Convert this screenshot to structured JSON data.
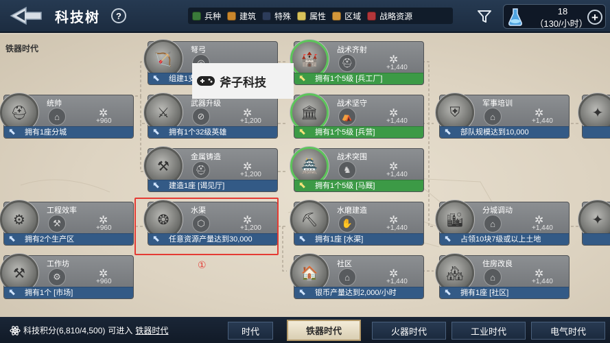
{
  "header": {
    "title": "科技树",
    "help_symbol": "?",
    "legend": [
      {
        "label": "兵种",
        "color": "#3a7a3a"
      },
      {
        "label": "建筑",
        "color": "#c9862c"
      },
      {
        "label": "特殊",
        "color": "#2c3c5a"
      },
      {
        "label": "属性",
        "color": "#d8c25a"
      },
      {
        "label": "区域",
        "color": "#d2963a"
      },
      {
        "label": "战略资源",
        "color": "#b2363a"
      }
    ],
    "resource": {
      "value": "18",
      "rate": "（130/小时）",
      "plus_symbol": "+"
    }
  },
  "tree": {
    "era_label": "铁器时代",
    "cards": [
      {
        "name": "弩弓",
        "points": "",
        "req": "组建1支",
        "req_style": "blue",
        "progress": false
      },
      {
        "name": "战术齐射",
        "points": "+1,440",
        "req": "拥有1个5级 [兵工厂]",
        "req_style": "green",
        "progress": true
      },
      {
        "name": "统帅",
        "points": "+960",
        "req": "拥有1座分城",
        "req_style": "blue",
        "progress": false
      },
      {
        "name": "武器升级",
        "points": "+1,200",
        "req": "拥有1个32级英雄",
        "req_style": "blue",
        "progress": false
      },
      {
        "name": "战术坚守",
        "points": "+1,440",
        "req": "拥有1个5级 [兵营]",
        "req_style": "green",
        "progress": true
      },
      {
        "name": "军事培训",
        "points": "+1,440",
        "req": "部队规模达到10,000",
        "req_style": "blue",
        "progress": false
      },
      {
        "name": "金属铸造",
        "points": "+1,200",
        "req": "建造1座 [谒见厅]",
        "req_style": "blue",
        "progress": false
      },
      {
        "name": "战术突围",
        "points": "+1,440",
        "req": "拥有1个5级 [马厩]",
        "req_style": "green",
        "progress": true
      },
      {
        "name": "工程效率",
        "points": "+960",
        "req": "拥有2个生产区",
        "req_style": "blue",
        "progress": false
      },
      {
        "name": "水渠",
        "points": "+1,200",
        "req": "任意资源产量达到30,000",
        "req_style": "blue",
        "progress": false
      },
      {
        "name": "水磨建造",
        "points": "+1,440",
        "req": "拥有1座 [水渠]",
        "req_style": "blue",
        "progress": false
      },
      {
        "name": "分城调动",
        "points": "+1,440",
        "req": "占领10块7级或以上土地",
        "req_style": "blue",
        "progress": false
      },
      {
        "name": "工作坊",
        "points": "+960",
        "req": "拥有1个 [市场]",
        "req_style": "blue",
        "progress": false
      },
      {
        "name": "社区",
        "points": "+1,440",
        "req": "银币产量达到2,000/小时",
        "req_style": "blue",
        "progress": false
      },
      {
        "name": "住房改良",
        "points": "+1,440",
        "req": "拥有1座 [社区]",
        "req_style": "blue",
        "progress": false
      }
    ],
    "annotation_number": "①",
    "watermark": "斧子科技"
  },
  "footer": {
    "points_label": "科技积分(6,810/4,500)",
    "can_enter": "可进入",
    "can_enter_link": "铁器时代",
    "era_tabs": [
      {
        "label": "时代",
        "active": false
      },
      {
        "label": "铁器时代",
        "active": true
      },
      {
        "label": "火器时代",
        "active": false
      },
      {
        "label": "工业时代",
        "active": false
      },
      {
        "label": "电气时代",
        "active": false
      }
    ]
  }
}
